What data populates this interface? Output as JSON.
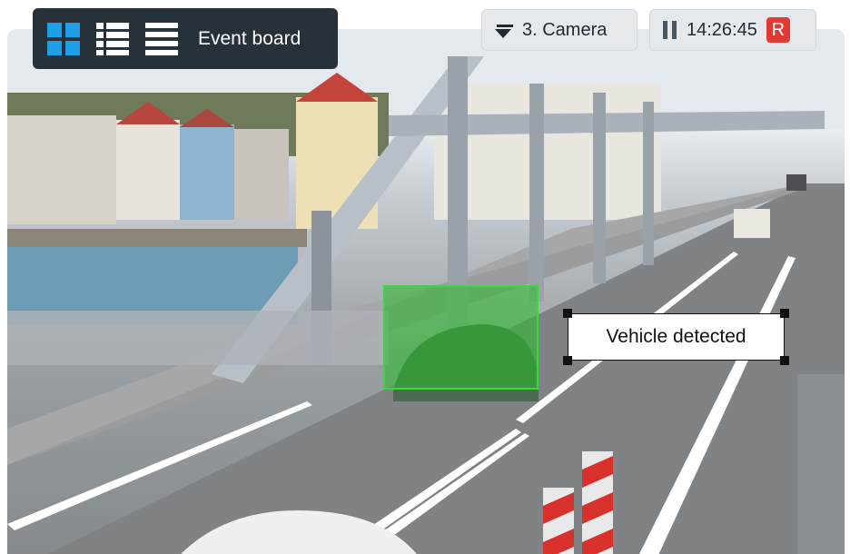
{
  "toolbar": {
    "view_grid_icon": "grid-view-icon",
    "view_list_icon": "list-view-icon",
    "view_rows_icon": "rows-view-icon",
    "label": "Event board",
    "active_color": "#1ea0e6"
  },
  "camera": {
    "label": "3. Camera"
  },
  "playback": {
    "time": "14:26:45",
    "record_badge": "R",
    "record_color": "#e23a33"
  },
  "detection": {
    "label": "Vehicle detected",
    "box_color": "#45d145"
  }
}
